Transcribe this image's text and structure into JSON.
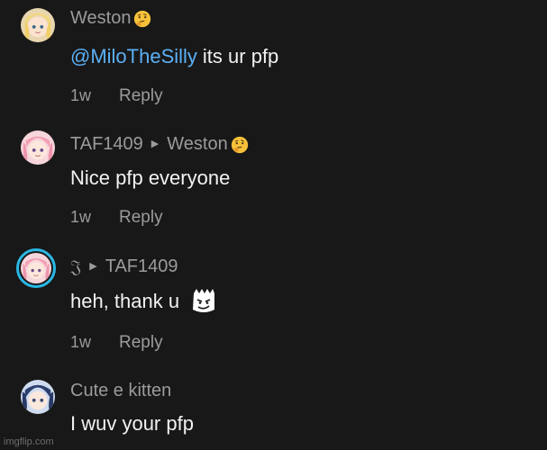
{
  "comments": [
    {
      "username": "Weston",
      "mention": "@MiloTheSilly",
      "text": "its ur pfp",
      "time": "1w",
      "reply_label": "Reply"
    },
    {
      "username": "TAF1409",
      "reply_to": "Weston",
      "text": "Nice pfp everyone",
      "time": "1w",
      "reply_label": "Reply"
    },
    {
      "username": "𝔍",
      "reply_to": "TAF1409",
      "text": "heh, thank u",
      "time": "1w",
      "reply_label": "Reply"
    },
    {
      "username": "Cute e kitten",
      "text": "I wuv your pfp"
    }
  ],
  "watermark": "imgflip.com",
  "colors": {
    "background": "#181818",
    "mention": "#5cb0f5",
    "secondary_text": "#9b9b9b",
    "story_ring": "#2ab8e6"
  },
  "icons": {
    "thinking_emoji": "thinking-face-emoji",
    "sticker": "bart-smirk-sticker"
  }
}
